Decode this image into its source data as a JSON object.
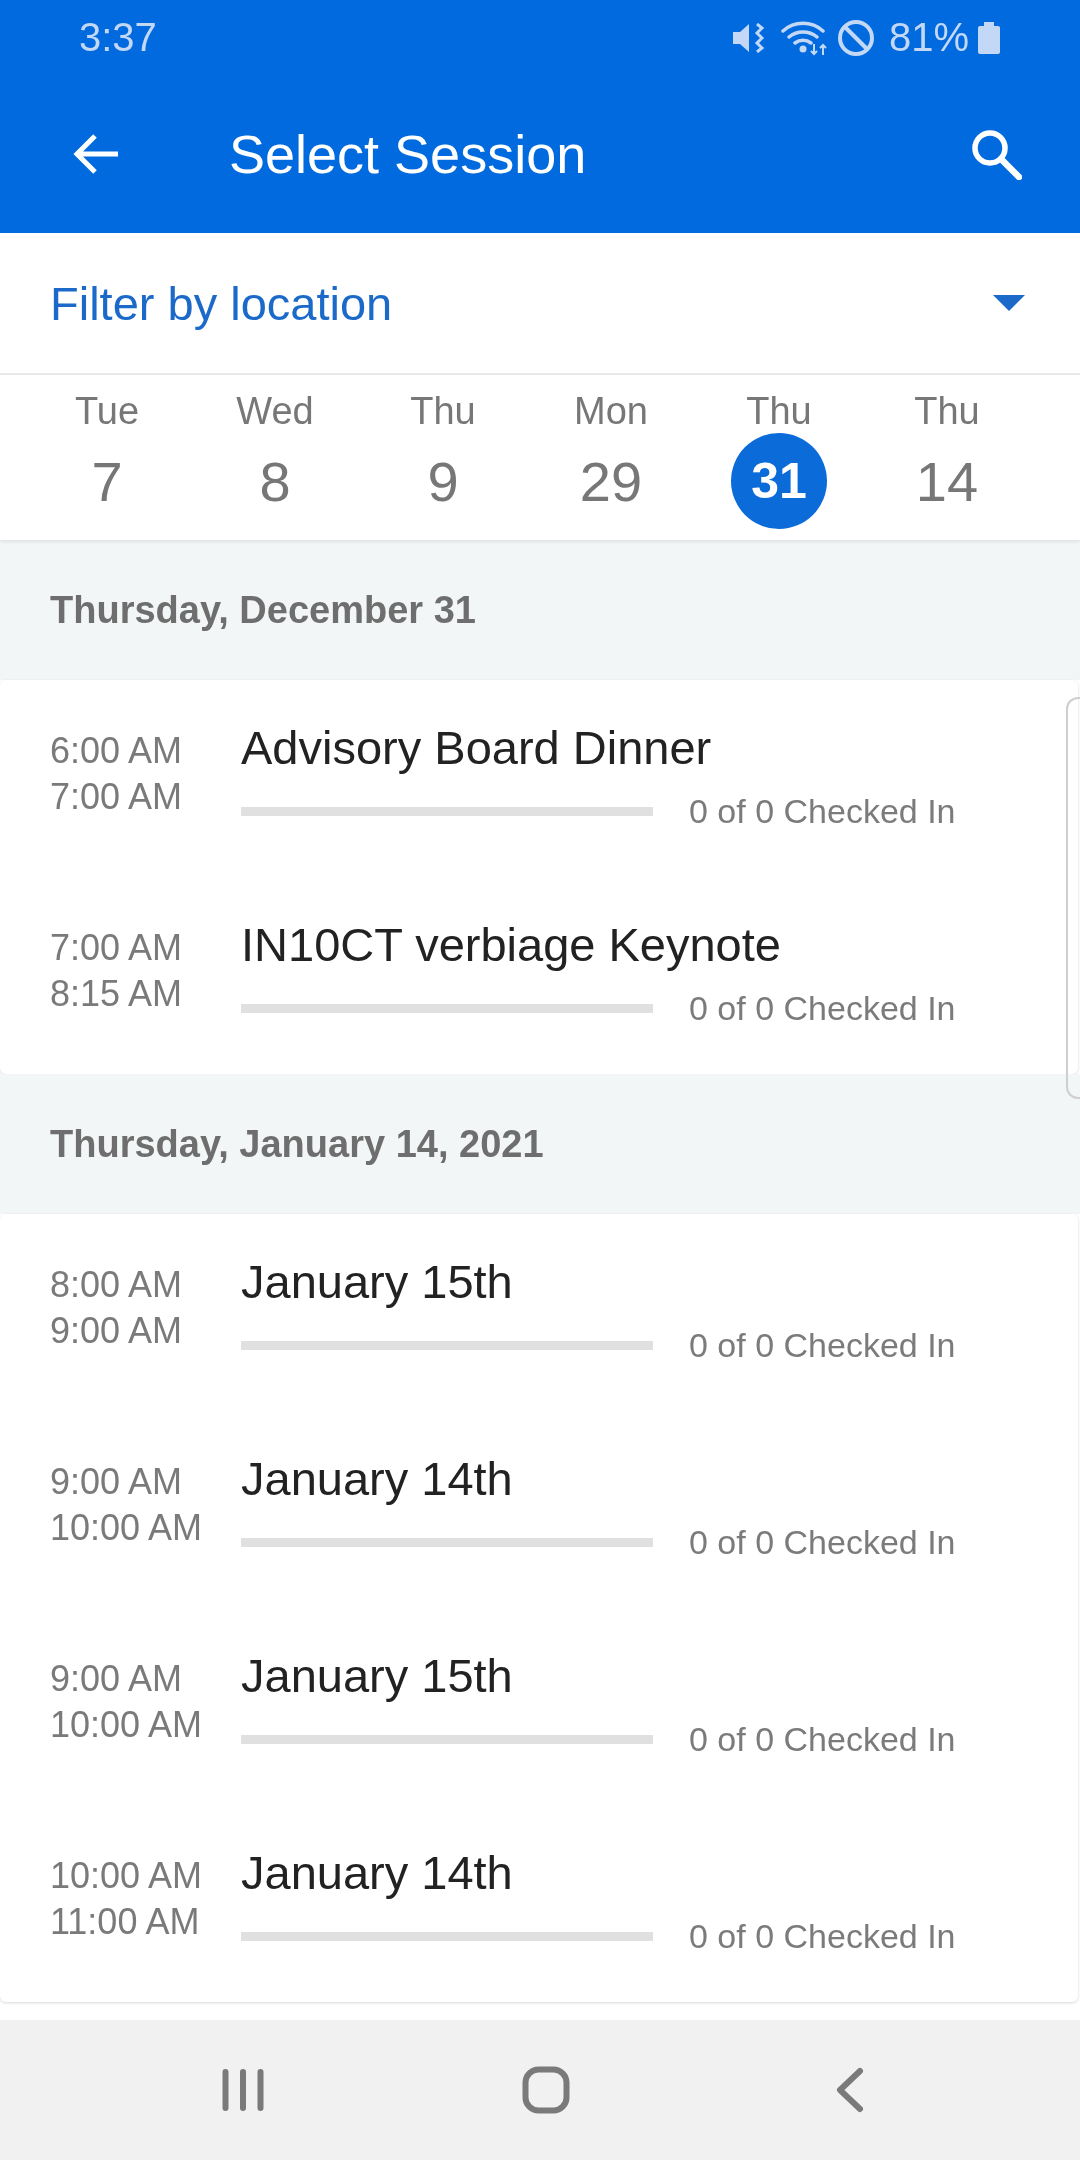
{
  "status_bar": {
    "time": "3:37",
    "battery": "81%"
  },
  "app_bar": {
    "title": "Select Session"
  },
  "filter": {
    "label": "Filter by location"
  },
  "dates": [
    {
      "weekday": "Tue",
      "day": "7",
      "selected": false
    },
    {
      "weekday": "Wed",
      "day": "8",
      "selected": false
    },
    {
      "weekday": "Thu",
      "day": "9",
      "selected": false
    },
    {
      "weekday": "Mon",
      "day": "29",
      "selected": false
    },
    {
      "weekday": "Thu",
      "day": "31",
      "selected": true
    },
    {
      "weekday": "Thu",
      "day": "14",
      "selected": false
    }
  ],
  "sections": [
    {
      "title": "Thursday, December 31",
      "sessions": [
        {
          "start": "6:00 AM",
          "end": "7:00 AM",
          "title": "Advisory Board Dinner",
          "level": 0,
          "checked_in": "0 of 0 Checked In"
        },
        {
          "start": "7:00 AM",
          "end": "8:15 AM",
          "title": "IN10CT verbiage Keynote",
          "level": 0,
          "checked_in": "0 of 0 Checked In"
        }
      ]
    },
    {
      "title": "Thursday, January 14, 2021",
      "sessions": [
        {
          "start": "8:00 AM",
          "end": "9:00 AM",
          "title": "January 15th",
          "level": 0,
          "checked_in": "0 of 0 Checked In"
        },
        {
          "start": "9:00 AM",
          "end": "10:00 AM",
          "title": "January 14th",
          "level": 0,
          "checked_in": "0 of 0 Checked In"
        },
        {
          "start": "9:00 AM",
          "end": "10:00 AM",
          "title": "January 15th",
          "level": 0,
          "checked_in": "0 of 0 Checked In"
        },
        {
          "start": "10:00 AM",
          "end": "11:00 AM",
          "title": "January 14th",
          "level": 0,
          "checked_in": "0 of 0 Checked In"
        }
      ]
    }
  ]
}
